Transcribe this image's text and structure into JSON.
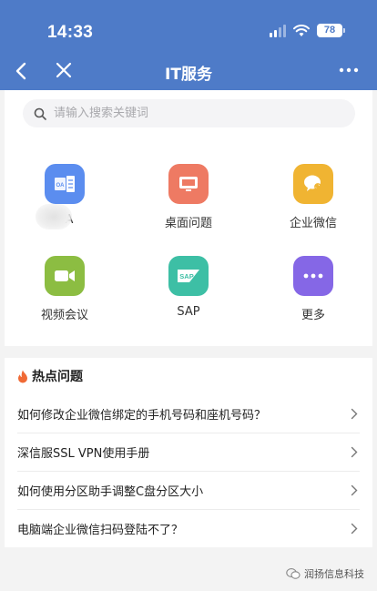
{
  "status_bar": {
    "time": "14:33",
    "battery": "78"
  },
  "nav": {
    "title": "IT服务"
  },
  "search": {
    "placeholder": "请输入搜索关键词"
  },
  "apps": [
    {
      "label": "OA",
      "color": "#5b8def",
      "icon": "oa-icon"
    },
    {
      "label": "桌面问题",
      "color": "#ee7a63",
      "icon": "monitor-icon"
    },
    {
      "label": "企业微信",
      "color": "#f0b432",
      "icon": "wecom-icon"
    },
    {
      "label": "视频会议",
      "color": "#8cbd42",
      "icon": "video-camera-icon"
    },
    {
      "label": "SAP",
      "color": "#3dbfa5",
      "icon": "sap-icon"
    },
    {
      "label": "更多",
      "color": "#8567e6",
      "icon": "more-dots-icon"
    }
  ],
  "hot": {
    "title": "热点问题",
    "items": [
      "如何修改企业微信绑定的手机号码和座机号码？",
      "深信服SSL VPN使用手册",
      "如何使用分区助手调整C盘分区大小",
      "电脑端企业微信扫码登陆不了？"
    ]
  },
  "watermark": "润扬信息科技",
  "colors": {
    "header": "#4e7bc8",
    "hot_icon": "#f06a35"
  }
}
